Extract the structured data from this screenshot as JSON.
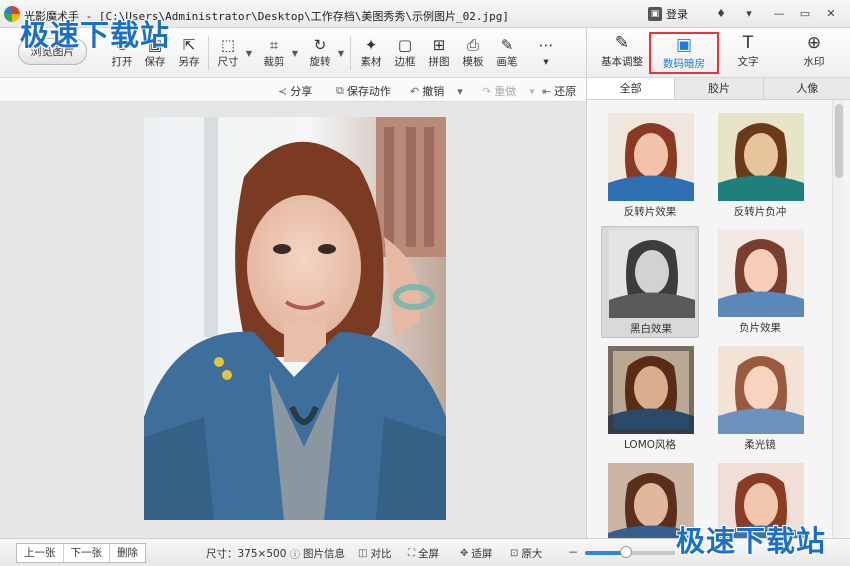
{
  "window": {
    "title": "光影魔术手 - [C:\\Users\\Administrator\\Desktop\\工作存档\\美图秀秀\\示例图片_02.jpg]",
    "login_label": "登录"
  },
  "watermark": "极速下载站",
  "toolbar": {
    "browse_label": "浏览图片",
    "tools": [
      {
        "label": "打开",
        "icon": "open-icon"
      },
      {
        "label": "保存",
        "icon": "save-icon"
      },
      {
        "label": "另存",
        "icon": "save-as-icon"
      },
      {
        "label": "尺寸",
        "icon": "resize-icon"
      },
      {
        "label": "裁剪",
        "icon": "crop-icon"
      },
      {
        "label": "旋转",
        "icon": "rotate-icon"
      },
      {
        "label": "素材",
        "icon": "material-icon"
      },
      {
        "label": "边框",
        "icon": "frame-icon"
      },
      {
        "label": "拼图",
        "icon": "collage-icon"
      },
      {
        "label": "模板",
        "icon": "template-icon"
      },
      {
        "label": "画笔",
        "icon": "brush-icon"
      }
    ]
  },
  "panel_tabs": [
    {
      "label": "基本调整",
      "icon": "adjust-icon"
    },
    {
      "label": "数码暗房",
      "icon": "darkroom-icon",
      "active": true
    },
    {
      "label": "文字",
      "icon": "text-icon"
    },
    {
      "label": "水印",
      "icon": "watermark-icon"
    }
  ],
  "actions": {
    "share": "分享",
    "save_action": "保存动作",
    "undo": "撤销",
    "redo": "重做",
    "restore": "还原"
  },
  "filter_tabs": [
    {
      "label": "全部",
      "active": true
    },
    {
      "label": "胶片"
    },
    {
      "label": "人像"
    }
  ],
  "filters": [
    {
      "label": "反转片效果"
    },
    {
      "label": "反转片负冲"
    },
    {
      "label": "黑白效果",
      "selected": true
    },
    {
      "label": "负片效果"
    },
    {
      "label": "LOMO风格"
    },
    {
      "label": "柔光镜"
    },
    {
      "label": ""
    },
    {
      "label": ""
    }
  ],
  "statusbar": {
    "prev": "上一张",
    "next": "下一张",
    "delete": "删除",
    "size": "尺寸：375×500",
    "info": "图片信息",
    "compare": "对比",
    "fullscreen": "全屏",
    "fit": "适屏",
    "original": "原大",
    "zoom_fraction": 0.45
  },
  "colors": {
    "accent": "#1a7fd8",
    "highlight_border": "#e33333",
    "watermark": "#1a70c8"
  }
}
